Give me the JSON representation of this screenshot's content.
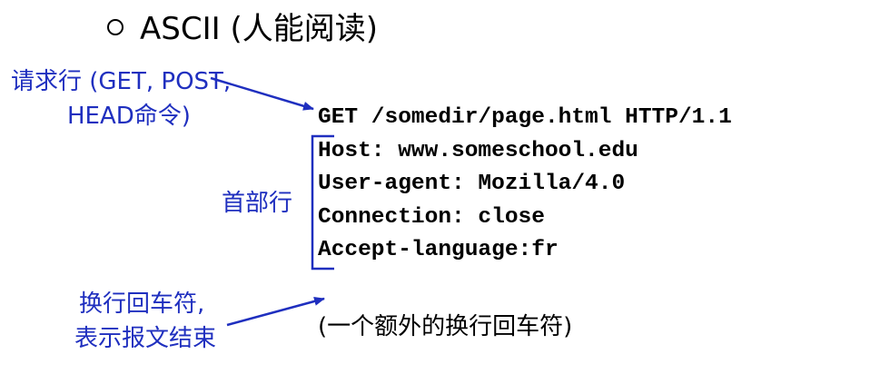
{
  "heading": {
    "bullet_icon": "hollow-circle-bullet",
    "text": "ASCII (人能阅读)"
  },
  "annotations": {
    "request_line_label_1": "请求行 (GET, POST,",
    "request_line_label_2": "HEAD命令)",
    "header_lines_label": "首部行",
    "crlf_label_1": "换行回车符,",
    "crlf_label_2": "表示报文结束",
    "extra_crlf": "(一个额外的换行回车符)"
  },
  "http_request": {
    "lines": [
      "GET /somedir/page.html HTTP/1.1",
      "Host: www.someschool.edu",
      "User-agent: Mozilla/4.0",
      "Connection: close",
      "Accept-language:fr"
    ]
  },
  "colors": {
    "annotation_blue": "#1f2fbf",
    "text_black": "#000000"
  }
}
